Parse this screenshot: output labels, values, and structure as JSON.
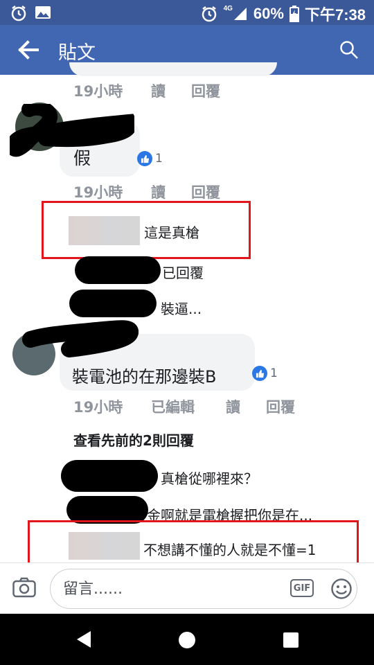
{
  "status_bar": {
    "battery": "60%",
    "network": "4G",
    "time": "下午7:38"
  },
  "app_bar": {
    "title": "貼文"
  },
  "comments": [
    {
      "meta": {
        "time": "19小時",
        "like": "讀",
        "reply": "回覆"
      }
    },
    {
      "text": "假",
      "like_count": "1",
      "meta": {
        "time": "19小時",
        "like": "讀",
        "reply": "回覆"
      },
      "reply_preview": {
        "text": "這是真槍"
      },
      "sub_lines": [
        "已回覆",
        "裝逼..."
      ]
    },
    {
      "text": "裝電池的在那邊裝B",
      "like_count": "1",
      "meta": {
        "time": "19小時",
        "edited": "已編輯",
        "like": "讀",
        "reply": "回覆"
      },
      "view_previous": "查看先前的2則回覆",
      "sub_lines": [
        "真槍從哪裡來？",
        "金啊就是電槍握把你是在..."
      ],
      "reply_preview": {
        "text": "不想講不懂的人就是不懂=1"
      }
    }
  ],
  "input": {
    "placeholder": "留言......",
    "gif_label": "GIF"
  },
  "colors": {
    "header": "#4267b2",
    "status": "#3b5998",
    "highlight_frame": "#e2151c",
    "like_blue": "#2a77e5"
  }
}
